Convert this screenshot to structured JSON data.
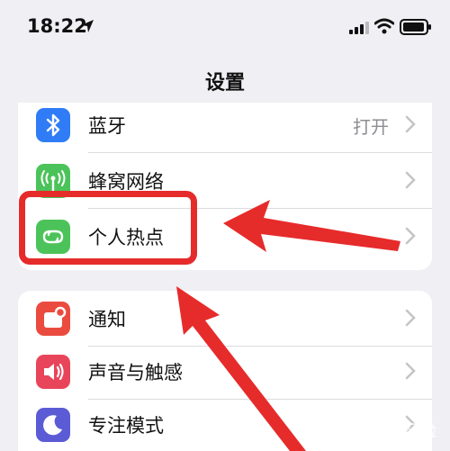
{
  "status_bar": {
    "time": "18:22",
    "icons": [
      "location-arrow-icon",
      "cellular-signal-icon",
      "wifi-icon",
      "battery-icon"
    ]
  },
  "nav": {
    "title": "设置"
  },
  "group1": {
    "items": [
      {
        "label": "蓝牙",
        "value": "打开",
        "icon": "bluetooth-icon",
        "icon_color": "#2f7cf6"
      },
      {
        "label": "蜂窝网络",
        "value": "",
        "icon": "cellular-antenna-icon",
        "icon_color": "#4cc35a"
      },
      {
        "label": "个人热点",
        "value": "",
        "icon": "personal-hotspot-icon",
        "icon_color": "#4cc35a"
      }
    ]
  },
  "group2": {
    "items": [
      {
        "label": "通知",
        "icon": "notification-bell-icon",
        "icon_color": "#eb4b3f"
      },
      {
        "label": "声音与触感",
        "icon": "speaker-icon",
        "icon_color": "#e8455b"
      },
      {
        "label": "专注模式",
        "icon": "moon-icon",
        "icon_color": "#5b5bd6"
      }
    ]
  },
  "annotation": {
    "color": "#e62b2b"
  },
  "watermark": {
    "text": "Bai经验"
  }
}
